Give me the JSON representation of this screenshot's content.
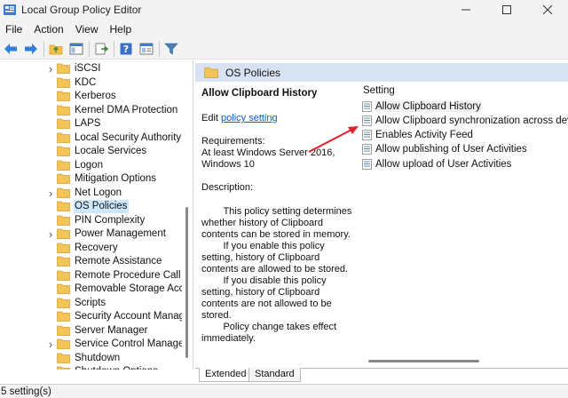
{
  "window": {
    "title": "Local Group Policy Editor"
  },
  "menu": [
    "File",
    "Action",
    "View",
    "Help"
  ],
  "toolbar": {
    "buttons": [
      "back-icon",
      "forward-icon",
      "folder-up-icon",
      "show-hide-tree-icon",
      "export-list-icon",
      "help-icon",
      "properties-icon",
      "filter-icon"
    ]
  },
  "tree": {
    "items": [
      {
        "label": "iSCSI",
        "expandable": true
      },
      {
        "label": "KDC",
        "expandable": false
      },
      {
        "label": "Kerberos",
        "expandable": false
      },
      {
        "label": "Kernel DMA Protection",
        "expandable": false
      },
      {
        "label": "LAPS",
        "expandable": false
      },
      {
        "label": "Local Security Authority",
        "expandable": false
      },
      {
        "label": "Locale Services",
        "expandable": false
      },
      {
        "label": "Logon",
        "expandable": false
      },
      {
        "label": "Mitigation Options",
        "expandable": false
      },
      {
        "label": "Net Logon",
        "expandable": true
      },
      {
        "label": "OS Policies",
        "expandable": false,
        "selected": true
      },
      {
        "label": "PIN Complexity",
        "expandable": false
      },
      {
        "label": "Power Management",
        "expandable": true
      },
      {
        "label": "Recovery",
        "expandable": false
      },
      {
        "label": "Remote Assistance",
        "expandable": false
      },
      {
        "label": "Remote Procedure Call",
        "expandable": false
      },
      {
        "label": "Removable Storage Access",
        "expandable": false
      },
      {
        "label": "Scripts",
        "expandable": false
      },
      {
        "label": "Security Account Manager",
        "expandable": false
      },
      {
        "label": "Server Manager",
        "expandable": false
      },
      {
        "label": "Service Control Manager Settings",
        "expandable": true
      },
      {
        "label": "Shutdown",
        "expandable": false
      },
      {
        "label": "Shutdown Options",
        "expandable": false
      }
    ]
  },
  "right": {
    "header_title": "OS Policies",
    "policy_title": "Allow Clipboard History",
    "edit_prefix": "Edit ",
    "edit_link": "policy setting ",
    "requirements_label": "Requirements:",
    "requirements_value": "At least Windows Server 2016, Windows 10",
    "description_label": "Description:",
    "description_text": "        This policy setting determines whether history of Clipboard contents can be stored in memory.\n        If you enable this policy setting, history of Clipboard contents are allowed to be stored.\n        If you disable this policy setting, history of Clipboard contents are not allowed to be stored.\n        Policy change takes effect immediately.",
    "setting_column": "Setting",
    "settings": [
      "Allow Clipboard History",
      "Allow Clipboard synchronization across devices",
      "Enables Activity Feed",
      "Allow publishing of User Activities",
      "Allow upload of User Activities"
    ]
  },
  "tabs": [
    "Extended",
    "Standard"
  ],
  "status": {
    "text": "5 setting(s)"
  },
  "colors": {
    "header_strip": "#d7e3f2",
    "selection": "#cce8ff",
    "link": "#0b5cc5",
    "annotation_arrow": "#e0202a"
  }
}
